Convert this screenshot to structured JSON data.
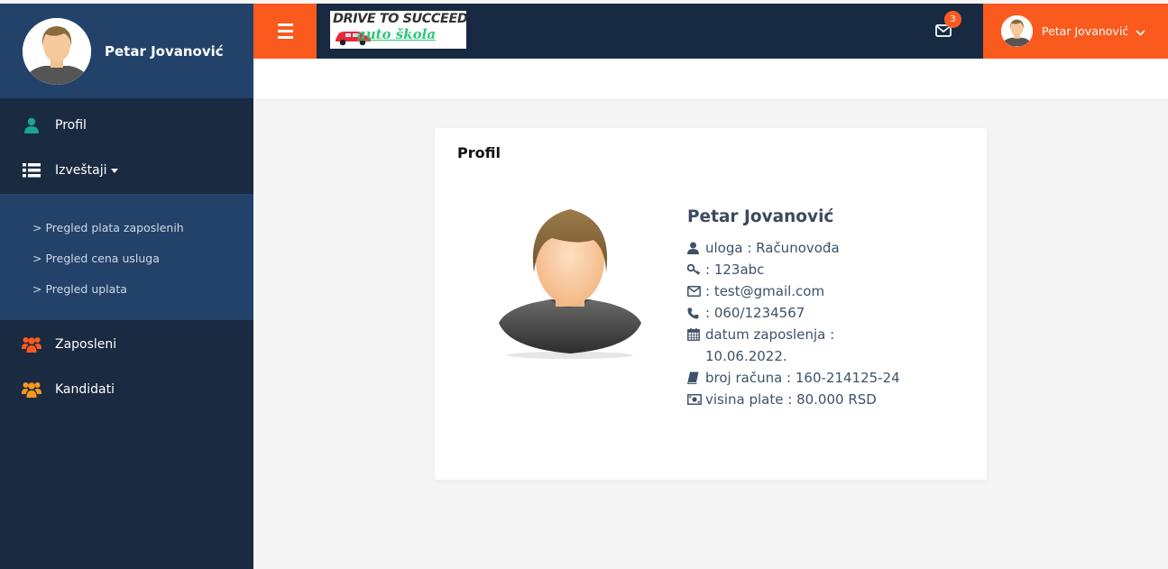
{
  "sidebar": {
    "user_name": "Petar Jovanović",
    "items": [
      {
        "label": "Profil",
        "icon": "user-icon"
      },
      {
        "label": "Izveštaji",
        "icon": "list-icon"
      },
      {
        "label": "Zaposleni",
        "icon": "users-icon"
      },
      {
        "label": "Kandidati",
        "icon": "users-icon"
      }
    ],
    "submenu": [
      {
        "label": "> Pregled plata zaposlenih"
      },
      {
        "label": "> Pregled cena usluga"
      },
      {
        "label": "> Pregled uplata"
      }
    ]
  },
  "topbar": {
    "logo_line1": "DRIVE TO SUCCEED",
    "logo_line2": "auto škola",
    "notification_count": "3",
    "user_name": "Petar Jovanović"
  },
  "profile": {
    "title": "Profil",
    "name": "Petar Jovanović",
    "role": "uloga : Računovođa",
    "password": ": 123abc",
    "email": ": test@gmail.com",
    "phone": ": 060/1234567",
    "employment_date": "datum zaposlenja : 10.06.2022.",
    "account": "broj računa : 160-214125-24",
    "salary": "visina plate : 80.000 RSD"
  },
  "colors": {
    "accent": "#fb5a1f",
    "sidebar_bg": "#1a2a40",
    "sidebar_header": "#22426a",
    "profil_icon": "#1aa58f",
    "zaposleni_icon": "#fb5a1f",
    "kandidati_icon": "#f59a1c"
  }
}
